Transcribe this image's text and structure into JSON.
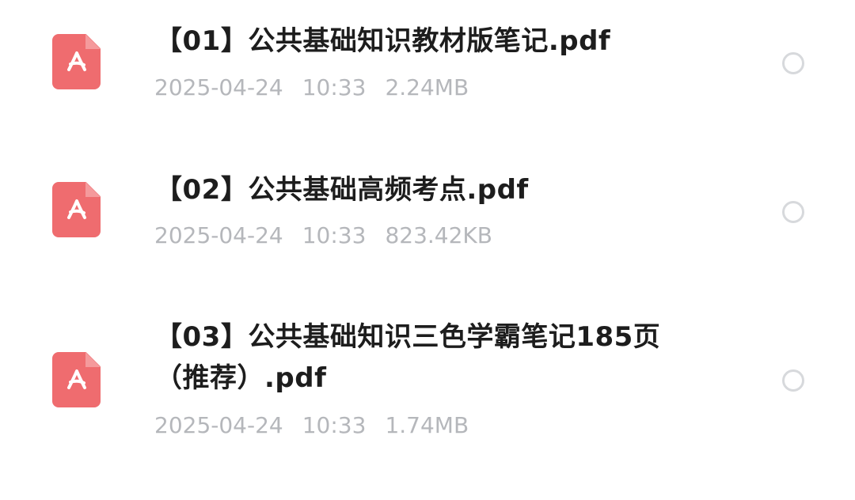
{
  "files": [
    {
      "title": "【01】公共基础知识教材版笔记.pdf",
      "date": "2025-04-24",
      "time": "10:33",
      "size": "2.24MB",
      "icon": "pdf-file-icon"
    },
    {
      "title": "【02】公共基础高频考点.pdf",
      "date": "2025-04-24",
      "time": "10:33",
      "size": "823.42KB",
      "icon": "pdf-file-icon"
    },
    {
      "title": "【03】公共基础知识三色学霸笔记185页（推荐）.pdf",
      "date": "2025-04-24",
      "time": "10:33",
      "size": "1.74MB",
      "icon": "pdf-file-icon"
    }
  ],
  "colors": {
    "pdf_icon": "#ef6c6f",
    "title_text": "#1d1d1d",
    "meta_text": "#b5b7bb",
    "radio_border": "#d7d9dc"
  }
}
